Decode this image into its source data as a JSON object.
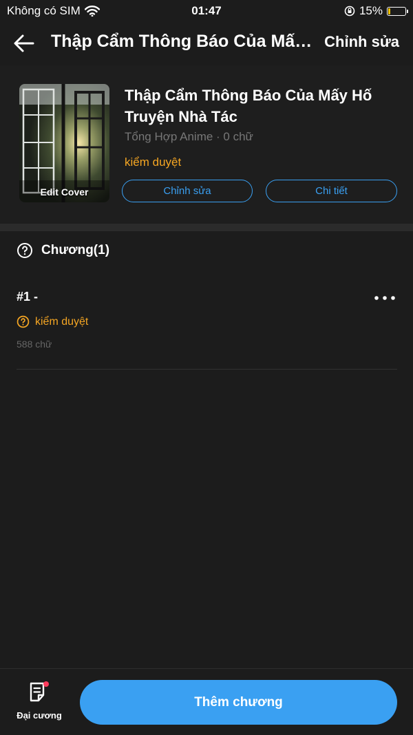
{
  "status_bar": {
    "carrier": "Không có SIM",
    "time": "01:47",
    "battery_percent": "15%",
    "battery_level": 0.15,
    "battery_color": "#f5c400"
  },
  "nav": {
    "back_icon": "back-arrow-icon",
    "title": "Thập Cẩm Thông Báo Của Mấy Hố Truyện Nhà Tác",
    "edit_label": "Chỉnh sửa"
  },
  "book": {
    "cover_label": "Edit Cover",
    "title": "Thập Cẩm Thông Báo Của Mấy Hố Truyện Nhà Tác",
    "meta": "Tổng Hợp Anime · 0 chữ",
    "status": "kiểm duyệt",
    "edit_button": "Chỉnh sửa",
    "detail_button": "Chi tiết"
  },
  "chapters": {
    "header_icon": "help-circle-icon",
    "header_label": "Chương(1)",
    "items": [
      {
        "number": "#1 -",
        "status": "kiểm duyệt",
        "words": "588 chữ",
        "more_icon": "more-icon"
      }
    ]
  },
  "bottom": {
    "outline_label": "Đại cương",
    "outline_icon": "outline-doc-icon",
    "add_chapter_label": "Thêm chương"
  },
  "colors": {
    "accent": "#3aa0f2",
    "pending": "#f5a623",
    "background": "#1c1c1c",
    "badge": "#ff3b5c"
  }
}
